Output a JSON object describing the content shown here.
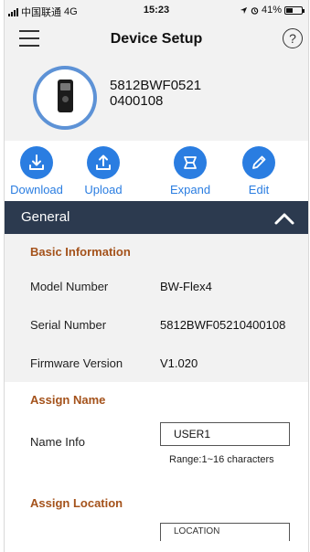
{
  "status_bar": {
    "carrier": "中国联通",
    "network": "4G",
    "time": "15:23",
    "battery": "41%",
    "battery_level": 0.41
  },
  "header": {
    "title": "Device Setup",
    "help": "?"
  },
  "device": {
    "name": "5812BWF0521 0400108"
  },
  "actions": [
    {
      "label": "Download",
      "icon": "download-icon"
    },
    {
      "label": "Upload",
      "icon": "upload-icon"
    },
    {
      "label": "Expand",
      "icon": "expand-icon"
    },
    {
      "label": "Edit",
      "icon": "edit-icon"
    }
  ],
  "section": {
    "title": "General",
    "expanded": true
  },
  "basic_info": {
    "heading": "Basic Information",
    "rows": [
      {
        "label": "Model Number",
        "value": "BW-Flex4"
      },
      {
        "label": "Serial Number",
        "value": "5812BWF05210400108"
      },
      {
        "label": "Firmware Version",
        "value": "V1.020"
      }
    ]
  },
  "assign_name": {
    "heading": "Assign Name",
    "label": "Name Info",
    "value": "USER1",
    "hint": "Range:1~16 characters"
  },
  "assign_location": {
    "heading": "Assign Location",
    "value": "LOCATION"
  },
  "colors": {
    "accent": "#2a7de1",
    "section_bar": "#2c3a4f",
    "heading": "#a4521b",
    "ring": "#5d92d6"
  }
}
